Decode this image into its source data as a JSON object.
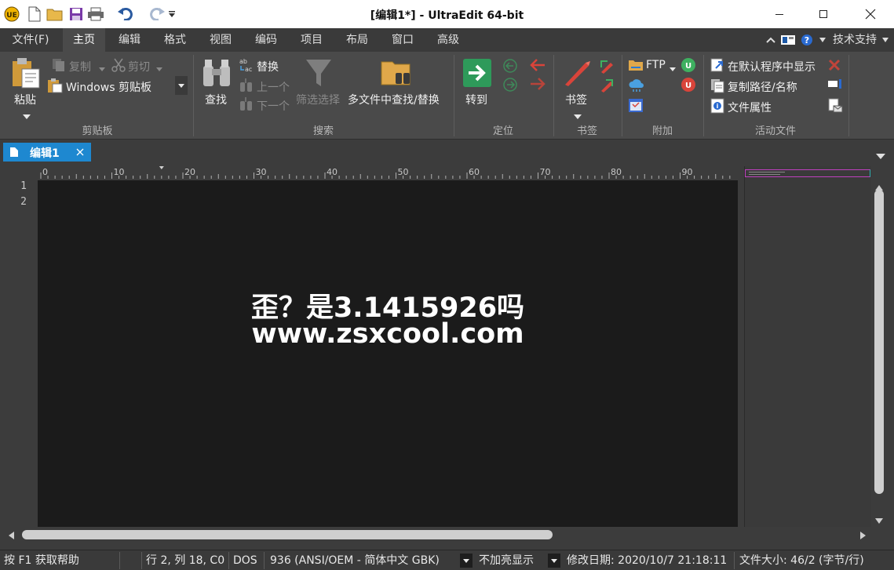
{
  "titlebar": {
    "title": "[编辑1*] - UltraEdit 64-bit",
    "quick_access": [
      "app-logo-icon",
      "new-file-icon",
      "open-folder-icon",
      "save-icon",
      "print-icon",
      "undo-icon",
      "redo-icon",
      "customize-dropdown-icon"
    ]
  },
  "menu": {
    "items": [
      "文件(F)",
      "主页",
      "编辑",
      "格式",
      "视图",
      "编码",
      "项目",
      "布局",
      "窗口",
      "高级"
    ],
    "active_index": 1,
    "support": "技术支持"
  },
  "ribbon": {
    "clipboard": {
      "paste": "粘贴",
      "copy": "复制",
      "cut": "剪切",
      "clipboard_select": "Windows 剪贴板",
      "group": "剪贴板"
    },
    "search": {
      "find": "查找",
      "replace": "替换",
      "prev": "上一个",
      "next": "下一个",
      "filter": "筛选选择",
      "multi": "多文件中查找/替换",
      "group": "搜索"
    },
    "position": {
      "goto": "转到",
      "group": "定位"
    },
    "bookmarks": {
      "bookmark": "书签",
      "group": "书签"
    },
    "extras": {
      "ftp": "FTP",
      "group": "附加"
    },
    "active_file": {
      "show_default": "在默认程序中显示",
      "copy_path": "复制路径/名称",
      "properties": "文件属性",
      "group": "活动文件"
    }
  },
  "tab": {
    "label": "编辑1"
  },
  "ruler": {
    "labels": [
      "0",
      "10",
      "20",
      "30",
      "40",
      "50",
      "60",
      "70",
      "80",
      "90"
    ]
  },
  "editor": {
    "line_numbers": [
      "1",
      "2"
    ],
    "watermark_line1": "歪？是3.1415926吗",
    "watermark_line2": "www.zsxcool.com"
  },
  "status": {
    "help": "按 F1 获取帮助",
    "position": "行 2, 列 18, C0",
    "line_ending": "DOS",
    "encoding": "936   (ANSI/OEM - 简体中文 GBK)",
    "highlight": "不加亮显示",
    "modified": "修改日期: 2020/10/7 21:18:11",
    "filesize": "文件大小: 46/2 (字节/行)"
  },
  "colors": {
    "accent": "#1e88d0",
    "editor_bg": "#1b1b1b",
    "goto_green": "#2e9a5a",
    "bookmark_red": "#d9443a"
  }
}
